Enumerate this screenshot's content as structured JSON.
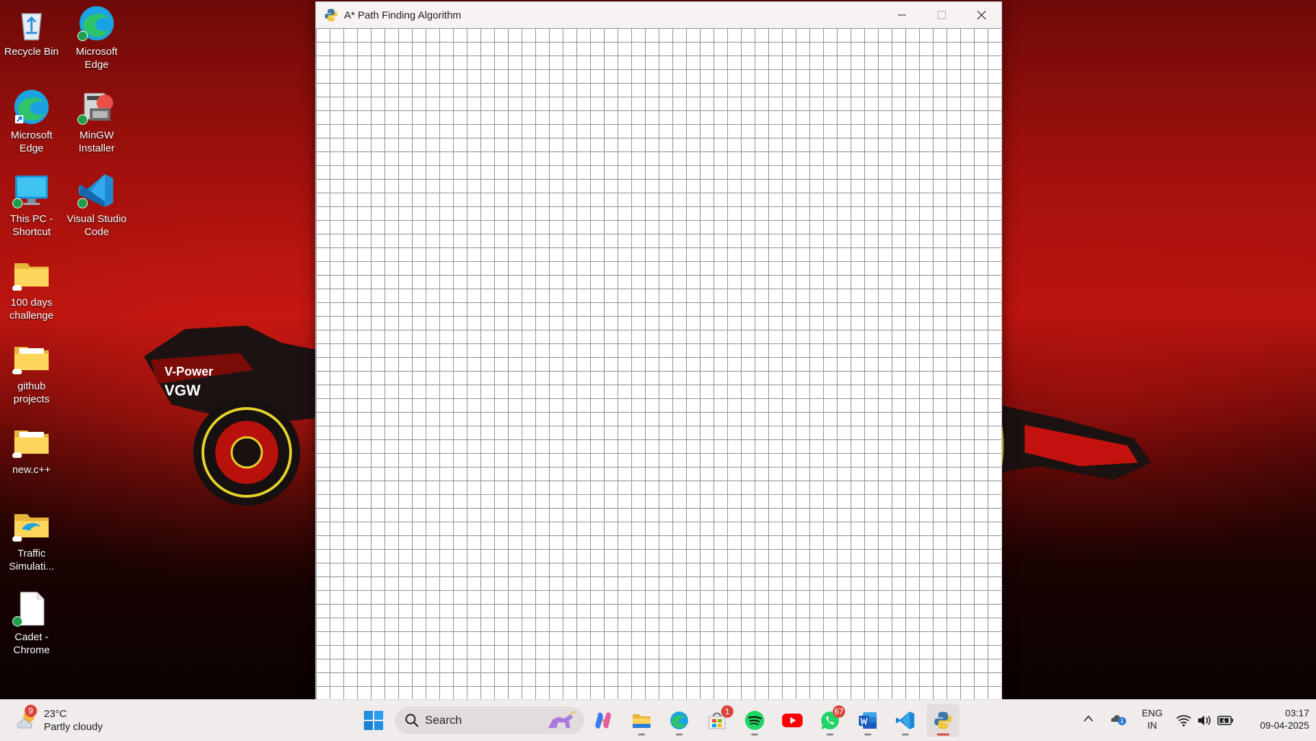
{
  "window": {
    "title": "A* Path Finding Algorithm",
    "minimize_icon": "minimize-icon",
    "maximize_icon": "maximize-icon",
    "close_icon": "close-icon"
  },
  "desktop": {
    "icons": [
      {
        "label": "Recycle Bin",
        "icon": "recycle-bin-icon"
      },
      {
        "label": "Microsoft Edge",
        "icon": "edge-icon"
      },
      {
        "label": "Microsoft Edge",
        "icon": "edge-shortcut-icon"
      },
      {
        "label": "MinGW Installer",
        "icon": "mingw-installer-icon"
      },
      {
        "label": "This PC - Shortcut",
        "icon": "monitor-icon"
      },
      {
        "label": "Visual Studio Code",
        "icon": "vscode-icon"
      },
      {
        "label": "100 days challenge",
        "icon": "folder-icon"
      },
      {
        "label": "github projects",
        "icon": "folder-icon"
      },
      {
        "label": "new.c++",
        "icon": "folder-icon"
      },
      {
        "label": "Traffic Simulati...",
        "icon": "folder-icon"
      },
      {
        "label": "Cadet - Chrome",
        "icon": "file-icon"
      }
    ]
  },
  "taskbar": {
    "weather": {
      "temp": "23°C",
      "condition": "Partly cloudy",
      "badge": "9"
    },
    "search_placeholder": "Search",
    "apps": [
      {
        "name": "start",
        "icon": "windows-start-icon"
      },
      {
        "name": "copilot",
        "icon": "copilot-icon"
      },
      {
        "name": "file-explorer",
        "icon": "folder-icon"
      },
      {
        "name": "edge",
        "icon": "edge-icon"
      },
      {
        "name": "microsoft-store",
        "icon": "store-icon",
        "badge": "1"
      },
      {
        "name": "spotify",
        "icon": "spotify-icon"
      },
      {
        "name": "youtube",
        "icon": "youtube-icon"
      },
      {
        "name": "whatsapp",
        "icon": "whatsapp-icon",
        "badge": "67"
      },
      {
        "name": "word",
        "icon": "word-icon"
      },
      {
        "name": "vscode",
        "icon": "vscode-icon"
      },
      {
        "name": "python",
        "icon": "python-icon"
      }
    ],
    "tray": {
      "language_line1": "ENG",
      "language_line2": "IN",
      "time": "03:17",
      "date": "09-04-2025"
    }
  },
  "colors": {
    "wallpaper_red": "#b9140f",
    "grid_line": "#8f8f8f",
    "badge_red": "#d9453b",
    "taskbar_bg": "#f1ecec"
  }
}
